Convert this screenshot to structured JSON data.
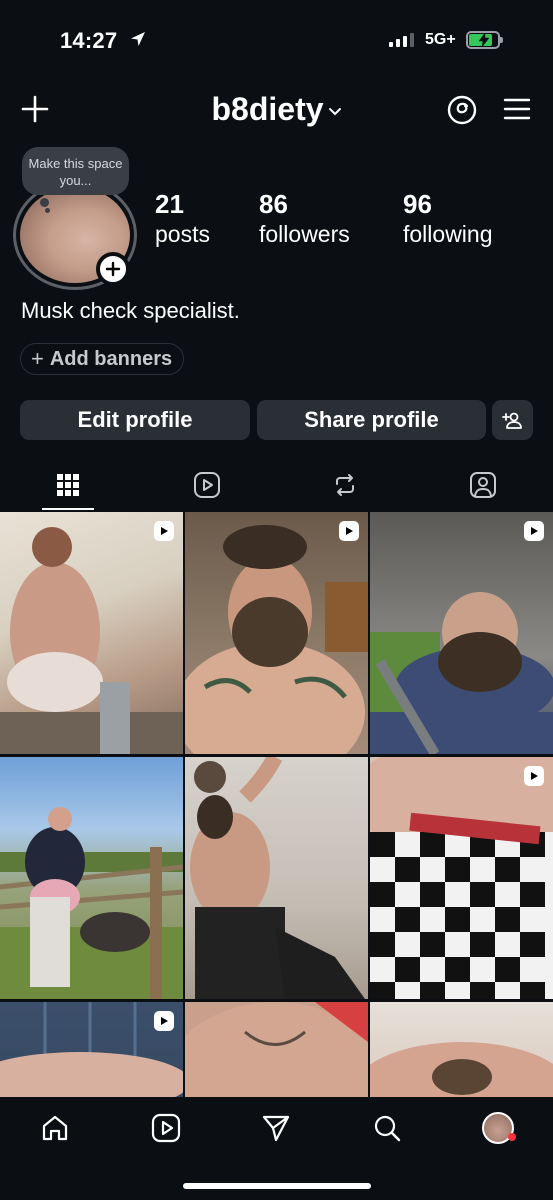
{
  "status_bar": {
    "time": "14:27",
    "network": "5G+",
    "battery_level": 0.78,
    "battery_color": "#34c759",
    "icons": [
      "location-arrow-icon",
      "signal-bars-icon",
      "battery-charging-icon"
    ]
  },
  "header": {
    "username": "b8diety",
    "icons": [
      "plus-icon",
      "chevron-down-icon",
      "threads-icon",
      "hamburger-menu-icon"
    ]
  },
  "profile": {
    "note_text": "Make this space you...",
    "stats": [
      {
        "value": "21",
        "label": "posts"
      },
      {
        "value": "86",
        "label": "followers"
      },
      {
        "value": "96",
        "label": "following"
      }
    ],
    "bio": "Musk check specialist.",
    "add_banners_label": "Add banners",
    "edit_profile_label": "Edit profile",
    "share_profile_label": "Share profile"
  },
  "tabs": [
    {
      "name": "grid-icon",
      "active": true
    },
    {
      "name": "reels-icon",
      "active": false
    },
    {
      "name": "reposts-icon",
      "active": false
    },
    {
      "name": "tagged-icon",
      "active": false
    }
  ],
  "grid_posts": [
    {
      "type": "reel"
    },
    {
      "type": "reel"
    },
    {
      "type": "reel"
    },
    {
      "type": "photo"
    },
    {
      "type": "photo"
    },
    {
      "type": "reel"
    },
    {
      "type": "reel"
    },
    {
      "type": "photo"
    },
    {
      "type": "photo"
    }
  ],
  "bottom_nav": [
    "home-icon",
    "reels-icon",
    "send-icon",
    "search-icon",
    "profile-avatar"
  ],
  "colors": {
    "background": "#0b0f14",
    "button": "#2a2e35",
    "notification_dot": "#ff3040"
  }
}
